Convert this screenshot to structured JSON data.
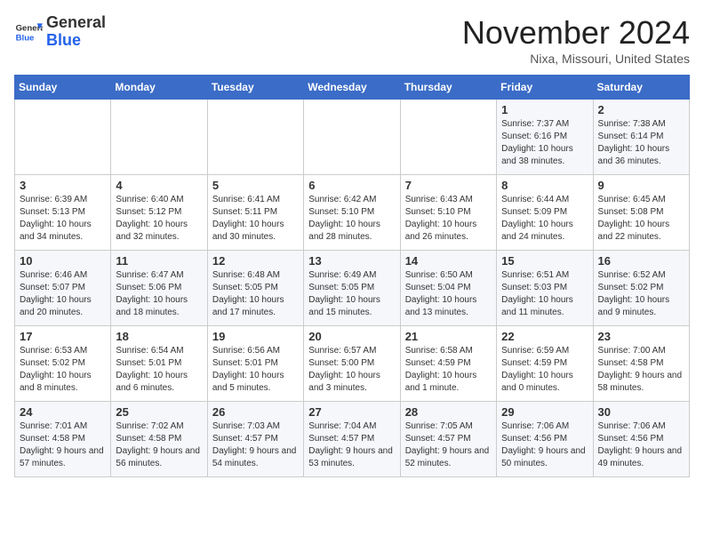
{
  "logo": {
    "general": "General",
    "blue": "Blue"
  },
  "header": {
    "month_title": "November 2024",
    "location": "Nixa, Missouri, United States"
  },
  "weekdays": [
    "Sunday",
    "Monday",
    "Tuesday",
    "Wednesday",
    "Thursday",
    "Friday",
    "Saturday"
  ],
  "weeks": [
    [
      {
        "num": "",
        "info": ""
      },
      {
        "num": "",
        "info": ""
      },
      {
        "num": "",
        "info": ""
      },
      {
        "num": "",
        "info": ""
      },
      {
        "num": "",
        "info": ""
      },
      {
        "num": "1",
        "info": "Sunrise: 7:37 AM\nSunset: 6:16 PM\nDaylight: 10 hours and 38 minutes."
      },
      {
        "num": "2",
        "info": "Sunrise: 7:38 AM\nSunset: 6:14 PM\nDaylight: 10 hours and 36 minutes."
      }
    ],
    [
      {
        "num": "3",
        "info": "Sunrise: 6:39 AM\nSunset: 5:13 PM\nDaylight: 10 hours and 34 minutes."
      },
      {
        "num": "4",
        "info": "Sunrise: 6:40 AM\nSunset: 5:12 PM\nDaylight: 10 hours and 32 minutes."
      },
      {
        "num": "5",
        "info": "Sunrise: 6:41 AM\nSunset: 5:11 PM\nDaylight: 10 hours and 30 minutes."
      },
      {
        "num": "6",
        "info": "Sunrise: 6:42 AM\nSunset: 5:10 PM\nDaylight: 10 hours and 28 minutes."
      },
      {
        "num": "7",
        "info": "Sunrise: 6:43 AM\nSunset: 5:10 PM\nDaylight: 10 hours and 26 minutes."
      },
      {
        "num": "8",
        "info": "Sunrise: 6:44 AM\nSunset: 5:09 PM\nDaylight: 10 hours and 24 minutes."
      },
      {
        "num": "9",
        "info": "Sunrise: 6:45 AM\nSunset: 5:08 PM\nDaylight: 10 hours and 22 minutes."
      }
    ],
    [
      {
        "num": "10",
        "info": "Sunrise: 6:46 AM\nSunset: 5:07 PM\nDaylight: 10 hours and 20 minutes."
      },
      {
        "num": "11",
        "info": "Sunrise: 6:47 AM\nSunset: 5:06 PM\nDaylight: 10 hours and 18 minutes."
      },
      {
        "num": "12",
        "info": "Sunrise: 6:48 AM\nSunset: 5:05 PM\nDaylight: 10 hours and 17 minutes."
      },
      {
        "num": "13",
        "info": "Sunrise: 6:49 AM\nSunset: 5:05 PM\nDaylight: 10 hours and 15 minutes."
      },
      {
        "num": "14",
        "info": "Sunrise: 6:50 AM\nSunset: 5:04 PM\nDaylight: 10 hours and 13 minutes."
      },
      {
        "num": "15",
        "info": "Sunrise: 6:51 AM\nSunset: 5:03 PM\nDaylight: 10 hours and 11 minutes."
      },
      {
        "num": "16",
        "info": "Sunrise: 6:52 AM\nSunset: 5:02 PM\nDaylight: 10 hours and 9 minutes."
      }
    ],
    [
      {
        "num": "17",
        "info": "Sunrise: 6:53 AM\nSunset: 5:02 PM\nDaylight: 10 hours and 8 minutes."
      },
      {
        "num": "18",
        "info": "Sunrise: 6:54 AM\nSunset: 5:01 PM\nDaylight: 10 hours and 6 minutes."
      },
      {
        "num": "19",
        "info": "Sunrise: 6:56 AM\nSunset: 5:01 PM\nDaylight: 10 hours and 5 minutes."
      },
      {
        "num": "20",
        "info": "Sunrise: 6:57 AM\nSunset: 5:00 PM\nDaylight: 10 hours and 3 minutes."
      },
      {
        "num": "21",
        "info": "Sunrise: 6:58 AM\nSunset: 4:59 PM\nDaylight: 10 hours and 1 minute."
      },
      {
        "num": "22",
        "info": "Sunrise: 6:59 AM\nSunset: 4:59 PM\nDaylight: 10 hours and 0 minutes."
      },
      {
        "num": "23",
        "info": "Sunrise: 7:00 AM\nSunset: 4:58 PM\nDaylight: 9 hours and 58 minutes."
      }
    ],
    [
      {
        "num": "24",
        "info": "Sunrise: 7:01 AM\nSunset: 4:58 PM\nDaylight: 9 hours and 57 minutes."
      },
      {
        "num": "25",
        "info": "Sunrise: 7:02 AM\nSunset: 4:58 PM\nDaylight: 9 hours and 56 minutes."
      },
      {
        "num": "26",
        "info": "Sunrise: 7:03 AM\nSunset: 4:57 PM\nDaylight: 9 hours and 54 minutes."
      },
      {
        "num": "27",
        "info": "Sunrise: 7:04 AM\nSunset: 4:57 PM\nDaylight: 9 hours and 53 minutes."
      },
      {
        "num": "28",
        "info": "Sunrise: 7:05 AM\nSunset: 4:57 PM\nDaylight: 9 hours and 52 minutes."
      },
      {
        "num": "29",
        "info": "Sunrise: 7:06 AM\nSunset: 4:56 PM\nDaylight: 9 hours and 50 minutes."
      },
      {
        "num": "30",
        "info": "Sunrise: 7:06 AM\nSunset: 4:56 PM\nDaylight: 9 hours and 49 minutes."
      }
    ]
  ]
}
